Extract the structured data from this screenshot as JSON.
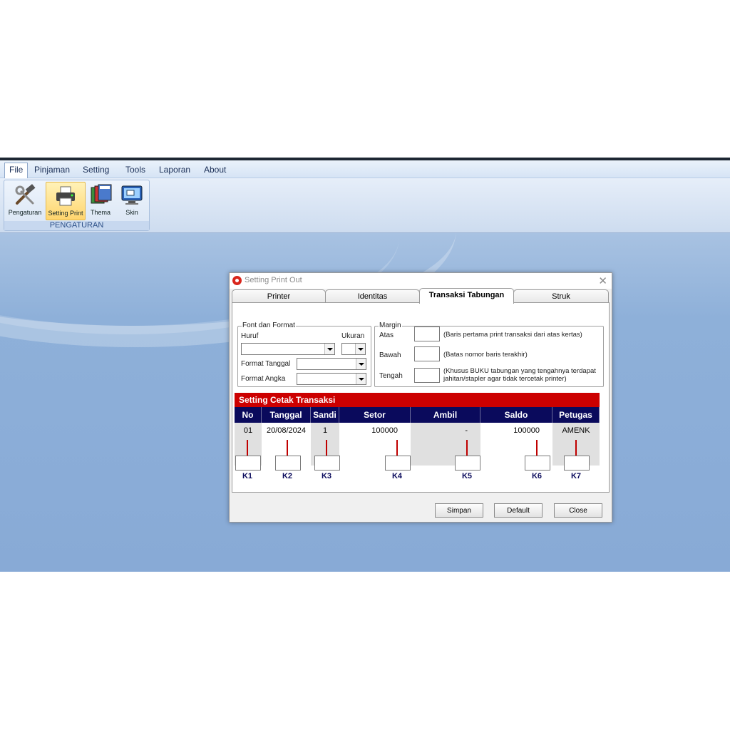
{
  "menu": [
    "File",
    "Pinjaman",
    "Setting",
    "Tools",
    "Laporan",
    "About"
  ],
  "ribbon": {
    "group_label": "PENGATURAN",
    "buttons": [
      {
        "label": "Pengaturan",
        "icon": "tools-icon"
      },
      {
        "label": "Setting Print",
        "icon": "printer-icon"
      },
      {
        "label": "Thema",
        "icon": "theme-icon"
      },
      {
        "label": "Skin",
        "icon": "skin-icon"
      }
    ]
  },
  "dialog": {
    "title": "Setting Print Out",
    "close": "✕",
    "tabs": [
      "Printer",
      "Identitas",
      "Transaksi Tabungan",
      "Struk"
    ],
    "font_group": {
      "legend": "Font dan Format",
      "huruf": "Huruf",
      "ukuran": "Ukuran",
      "format_tanggal": "Format Tanggal",
      "format_angka": "Format Angka"
    },
    "margin_group": {
      "legend": "Margin",
      "atas": "Atas",
      "atas_desc": "(Baris pertama print transaksi dari atas kertas)",
      "bawah": "Bawah",
      "bawah_desc": "(Batas nomor baris terakhir)",
      "tengah": "Tengah",
      "tengah_desc1": "(Khusus BUKU tabungan yang tengahnya terdapat",
      "tengah_desc2": "jahitan/stapler agar tidak tercetak printer)"
    },
    "grid": {
      "title": "Setting Cetak Transaksi",
      "headers": [
        "No",
        "Tanggal",
        "Sandi",
        "Setor",
        "Ambil",
        "Saldo",
        "Petugas"
      ],
      "row": [
        "01",
        "20/08/2024",
        "1",
        "100000",
        "-",
        "100000",
        "AMENK"
      ],
      "k_labels": [
        "K1",
        "K2",
        "K3",
        "K4",
        "K5",
        "K6",
        "K7"
      ]
    },
    "buttons": {
      "simpan": "Simpan",
      "default": "Default",
      "close": "Close"
    }
  },
  "colors": {
    "grid_title": "#cc0000",
    "grid_header": "#0a0a5c",
    "workspace": "#8eb0d9"
  }
}
